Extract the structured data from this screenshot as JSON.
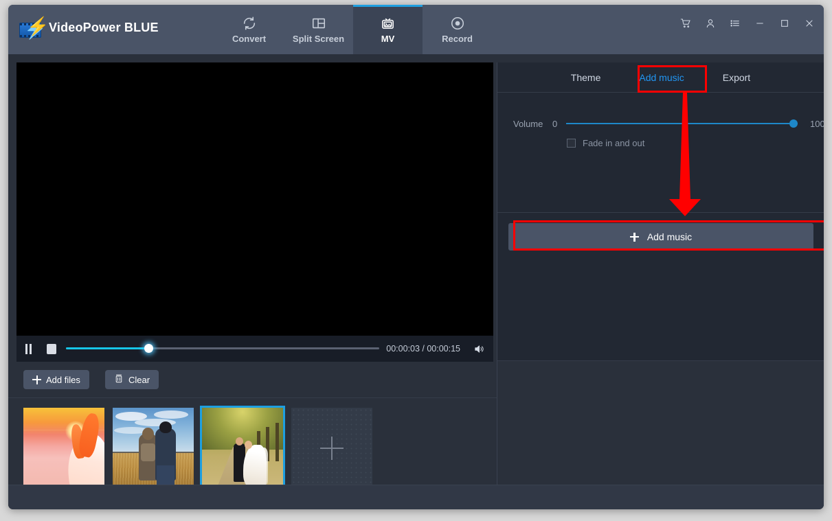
{
  "app": {
    "title": "VideoPower BLUE",
    "logo_icon": "film-lightning-logo"
  },
  "nav_tabs": [
    {
      "label": "Convert",
      "icon": "refresh-icon",
      "active": false
    },
    {
      "label": "Split Screen",
      "icon": "split-screen-icon",
      "active": false
    },
    {
      "label": "MV",
      "icon": "tv-picture-icon",
      "active": true
    },
    {
      "label": "Record",
      "icon": "record-dot-icon",
      "active": false
    }
  ],
  "window_controls": [
    {
      "name": "cart-icon"
    },
    {
      "name": "user-icon"
    },
    {
      "name": "menu-list-icon"
    },
    {
      "name": "minimize-icon"
    },
    {
      "name": "maximize-icon"
    },
    {
      "name": "close-icon"
    }
  ],
  "player": {
    "pause_label": "Pause",
    "stop_label": "Stop",
    "time": "00:00:03 / 00:00:15",
    "current_time": "00:00:03",
    "total_time": "00:00:15",
    "progress_percent": 26,
    "volume_icon": "speaker-icon"
  },
  "toolbar": {
    "add_files_label": "Add files",
    "clear_label": "Clear"
  },
  "thumbnails": [
    {
      "name": "thumbnail-sunset-bride",
      "selected": false
    },
    {
      "name": "thumbnail-couple-field",
      "selected": false
    },
    {
      "name": "thumbnail-wedding-path",
      "selected": true
    },
    {
      "name": "thumbnail-add-slot",
      "selected": false,
      "placeholder_icon": "plus-icon"
    }
  ],
  "right_panel": {
    "tabs": [
      {
        "label": "Theme",
        "active": false
      },
      {
        "label": "Add music",
        "active": true
      },
      {
        "label": "Export",
        "active": false
      }
    ],
    "volume": {
      "label": "Volume",
      "min_label": "0",
      "max_label": "100",
      "value": 100
    },
    "fade": {
      "label": "Fade in and out",
      "checked": false
    },
    "add_music_button": {
      "label": "Add music",
      "icon": "plus-icon"
    }
  },
  "annotations": {
    "highlight_color": "#ff0000",
    "arrow": "down-arrow-from-add-music-tab-to-add-music-button"
  },
  "colors": {
    "accent": "#1e9fe0",
    "tab_active_text": "#2196f3",
    "titlebar_bg": "#4a5467",
    "app_bg": "#2a303b",
    "panel_bg": "#222833",
    "button_bg": "#4a5467",
    "seek_fill": "#16c6e8",
    "annotation": "#ff0000"
  }
}
